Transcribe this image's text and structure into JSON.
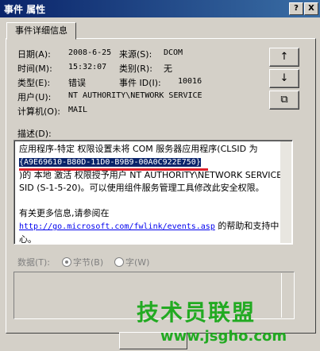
{
  "window": {
    "title": "事件 属性",
    "help_btn": "?",
    "close_btn": "X"
  },
  "tabs": [
    {
      "label": "事件详细信息"
    }
  ],
  "fields": {
    "date_label": "日期(A):",
    "date_value": "2008-6-25",
    "source_label": "来源(S):",
    "source_value": "DCOM",
    "time_label": "时间(M):",
    "time_value": "15:32:07",
    "category_label": "类别(R):",
    "category_value": "无",
    "type_label": "类型(E):",
    "type_value": "错误",
    "event_id_label": "事件 ID(I):",
    "event_id_value": "10016",
    "user_label": "用户(U):",
    "user_value": "NT AUTHORITY\\NETWORK SERVICE",
    "computer_label": "计算机(O):",
    "computer_value": "MAIL"
  },
  "side_buttons": {
    "up": "↑",
    "down": "↓",
    "copy": "⧉"
  },
  "description": {
    "label": "描述(D):",
    "line1": "应用程序-特定 权限设置未将 COM 服务器应用程序(CLSID 为",
    "clsid": "{A9E69610-B80D-11D0-B9B9-00A0C922E750}",
    "line2": ")的 本地 激活 权限授予用户 NT AUTHORITY\\NETWORK SERVICE",
    "line3": "SID (S-1-5-20)。可以使用组件服务管理工具修改此安全权限。",
    "more_info": "有关更多信息,请参阅在",
    "link": "http://go.microsoft.com/fwlink/events.asp",
    "link_suffix": "的帮助和支持中",
    "link_suffix2": "心。"
  },
  "data_section": {
    "label": "数据(T):",
    "bytes": "字节(B)",
    "words": "字(W)"
  },
  "watermark": {
    "text": "技术员联盟",
    "url": "www.jsgho.com"
  }
}
